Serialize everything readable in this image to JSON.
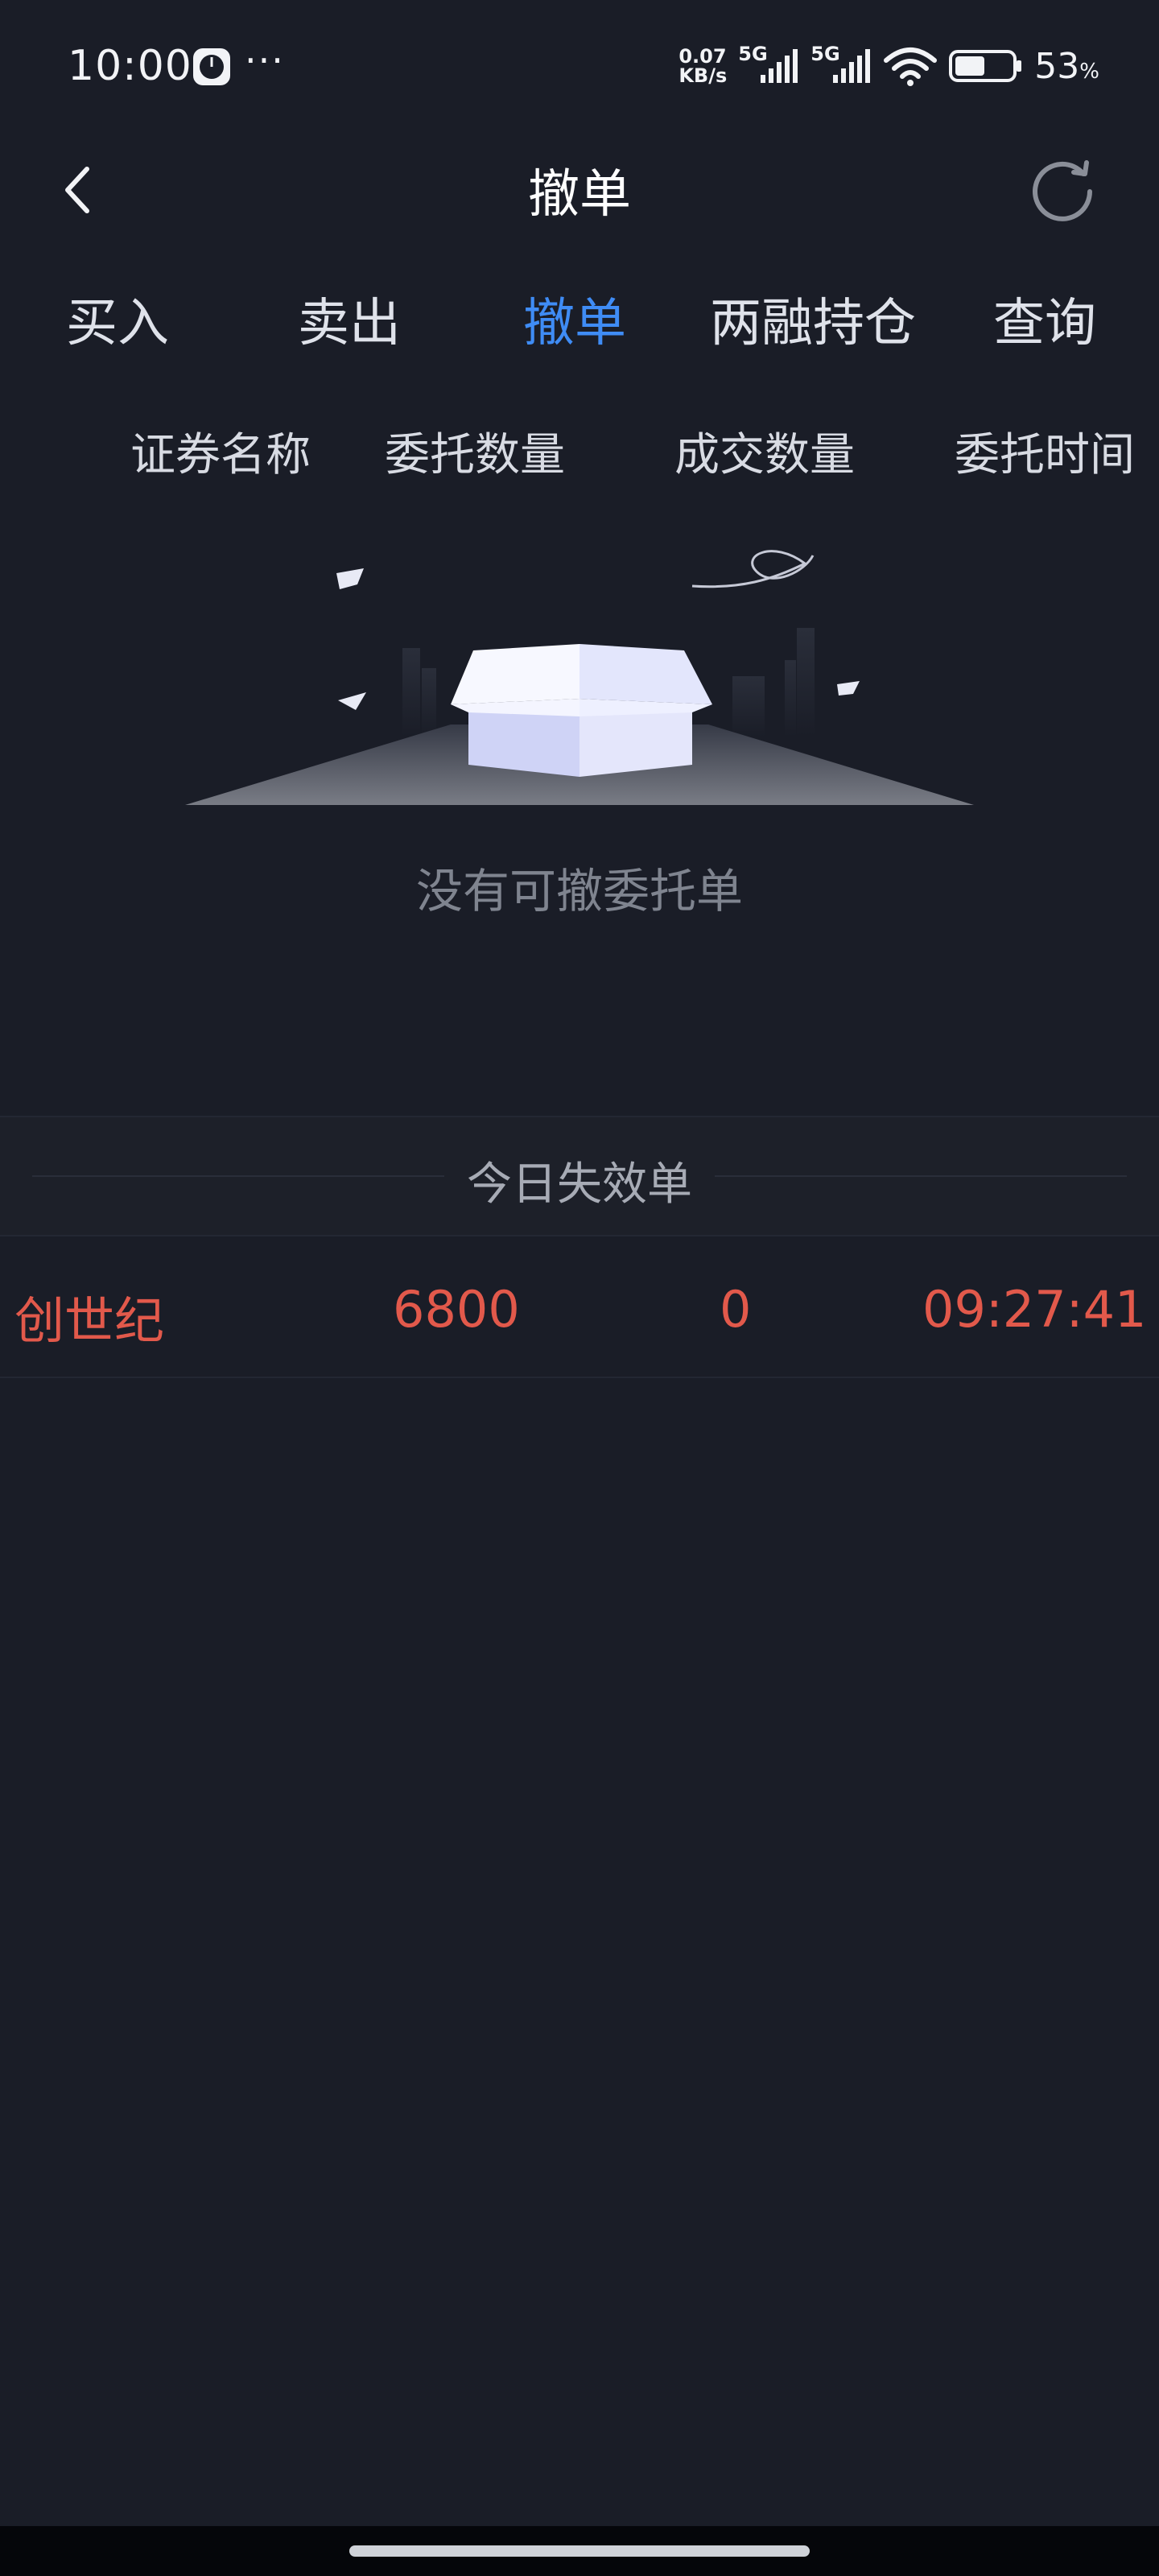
{
  "status_bar": {
    "time": "10:00",
    "more": "···",
    "speed_value": "0.07",
    "speed_unit": "KB/s",
    "network_1": "5G",
    "network_2": "5G",
    "battery_value": "53",
    "battery_unit": "%",
    "battery_level": 0.53
  },
  "nav": {
    "title": "撤单"
  },
  "tabs": [
    {
      "label": "买入",
      "active": false
    },
    {
      "label": "卖出",
      "active": false
    },
    {
      "label": "撤单",
      "active": true
    },
    {
      "label": "两融持仓",
      "active": false
    },
    {
      "label": "查询",
      "active": false
    }
  ],
  "columns": [
    "证券名称",
    "委托数量",
    "成交数量",
    "委托时间"
  ],
  "empty_state": {
    "text": "没有可撤委托单"
  },
  "expired_section": {
    "title": "今日失效单",
    "rows": [
      {
        "name": "创世纪",
        "quantity": "6800",
        "filled": "0",
        "time": "09:27:41"
      }
    ]
  },
  "colors": {
    "background": "#1a1d27",
    "accent": "#3f8cf5",
    "sell_red": "#e2594b"
  }
}
